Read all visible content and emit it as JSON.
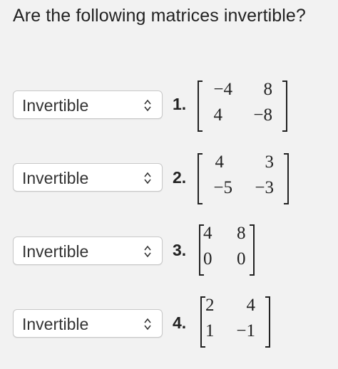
{
  "question": "Are the following matrices invertible?",
  "items": [
    {
      "number": "1.",
      "select": "Invertible",
      "matrix": [
        [
          "−4",
          "8"
        ],
        [
          "4",
          "−8"
        ]
      ]
    },
    {
      "number": "2.",
      "select": "Invertible",
      "matrix": [
        [
          "4",
          "3"
        ],
        [
          "−5",
          "−3"
        ]
      ]
    },
    {
      "number": "3.",
      "select": "Invertible",
      "matrix": [
        [
          "4",
          "8"
        ],
        [
          "0",
          "0"
        ]
      ]
    },
    {
      "number": "4.",
      "select": "Invertible",
      "matrix": [
        [
          "2",
          "4"
        ],
        [
          "1",
          "−1"
        ]
      ]
    }
  ],
  "icons": {
    "select_chevron": "chevron-up-down-icon"
  }
}
